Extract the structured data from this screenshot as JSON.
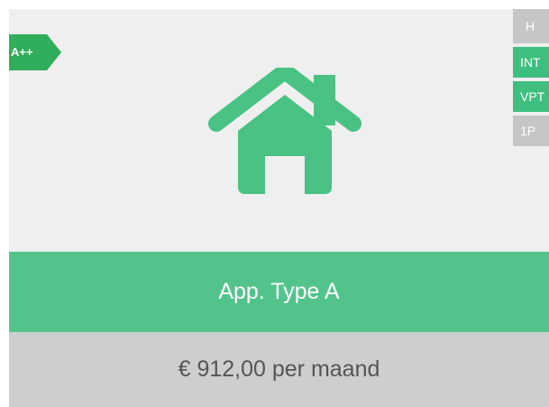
{
  "listing": {
    "energy_label": "A++",
    "image_icon": "house-icon",
    "tags": [
      "H",
      "INT",
      "VPT",
      "1P"
    ],
    "title": "App. Type A",
    "price": "€ 912,00 per maand"
  },
  "colors": {
    "accent_green": "#52c48b",
    "label_green": "#2fae5b",
    "tag_grey": "#c6c6c6",
    "tag_green": "#3fbf7f",
    "price_bg": "#cecece",
    "card_bg": "#efefef"
  }
}
